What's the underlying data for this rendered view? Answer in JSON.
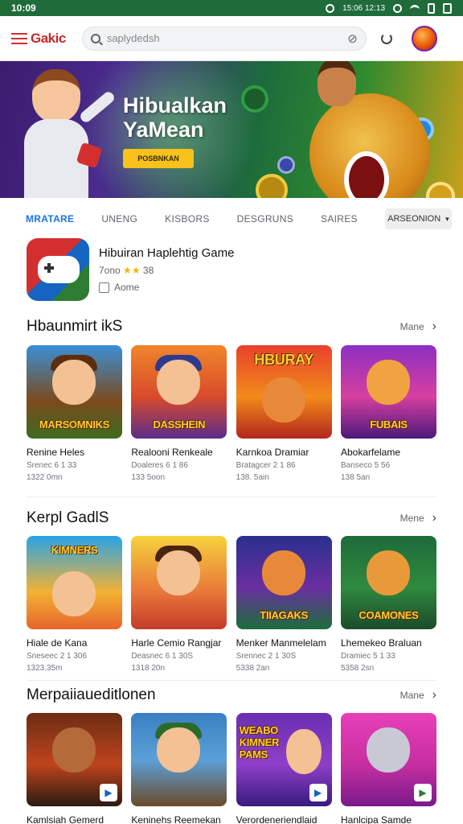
{
  "status_bar": {
    "time": "10:09",
    "right_text": "15:06 12:13"
  },
  "app": {
    "logo": "Gakic",
    "search_placeholder": "saplydedsh"
  },
  "banner": {
    "title_line1": "Hibualkan",
    "title_line2": "YaMean",
    "cta_label": "POSBNKAN"
  },
  "tabs": {
    "items": [
      "MRATARE",
      "UNENG",
      "KISBORS",
      "DESGRUNS",
      "SAIRES"
    ],
    "active_index": 0,
    "select_label": "ARSEONION"
  },
  "featured": {
    "title": "Hibuiran Haplehtig Game",
    "rating_text": "7ono",
    "rating_count": "38",
    "tag_label": "Aome"
  },
  "sections": [
    {
      "title": "Hbaunmirt ikS",
      "more_label": "Mane",
      "cards": [
        {
          "thumb_label": "MARSOMNIKS",
          "title": "Renine Heles",
          "subtitle": "Srenec 6 1 33",
          "size": "1322 0mn"
        },
        {
          "thumb_label": "DASSHEIN",
          "title": "Realooni Renkeale",
          "subtitle": "Doaleres 6 1 86",
          "size": "133 5oon"
        },
        {
          "thumb_label": "HBURAY",
          "title": "Karnkoa Dramiar",
          "subtitle": "Bratagcer 2 1 86",
          "size": "138. 5ain"
        },
        {
          "thumb_label": "FUBAIS",
          "title": "Abokarfelame",
          "subtitle": "Banseco 5 56",
          "size": "138 5an"
        }
      ]
    },
    {
      "title": "Kerpl GadlS",
      "more_label": "Mene",
      "cards": [
        {
          "thumb_label": "KIMNERS",
          "title": "Hiale de Kana",
          "subtitle": "Sneseec 2 1 306",
          "size": "1323.35m"
        },
        {
          "thumb_label": "",
          "title": "Harle Cemio Rangjar",
          "subtitle": "Deasnec 6 1 30S",
          "size": "1318 20n"
        },
        {
          "thumb_label": "TIIAGAKS",
          "title": "Menker Manmelelam",
          "subtitle": "Srennec 2 1 30S",
          "size": "5338 2an"
        },
        {
          "thumb_label": "COAMONES",
          "title": "Lhemekeo Braluan",
          "subtitle": "Dramiec 5 1 33",
          "size": "5358 2sn"
        }
      ]
    },
    {
      "title": "Merpaiiaueditlonen",
      "more_label": "Mane",
      "cards": [
        {
          "thumb_label": "",
          "title": "Kamlsiah Gemerd",
          "subtitle": "",
          "size": ""
        },
        {
          "thumb_label": "",
          "title": "Keninehs Reemekan",
          "subtitle": "",
          "size": ""
        },
        {
          "thumb_label": "WEABO KIMNER PAMS",
          "title": "Verordeneriendlaid",
          "subtitle": "",
          "size": ""
        },
        {
          "thumb_label": "",
          "title": "Hanlcipa Samde",
          "subtitle": "",
          "size": ""
        }
      ]
    }
  ],
  "colors": {
    "status_bar": "#1f6b3a",
    "accent": "#1a73e8",
    "cta": "#f6c21b",
    "star": "#f4b400"
  },
  "icons": [
    "menu-icon",
    "search-icon",
    "clear-icon",
    "refresh-icon",
    "avatar",
    "star-icon",
    "chevron-right-icon",
    "chevron-down-icon",
    "play-badge-icon"
  ]
}
